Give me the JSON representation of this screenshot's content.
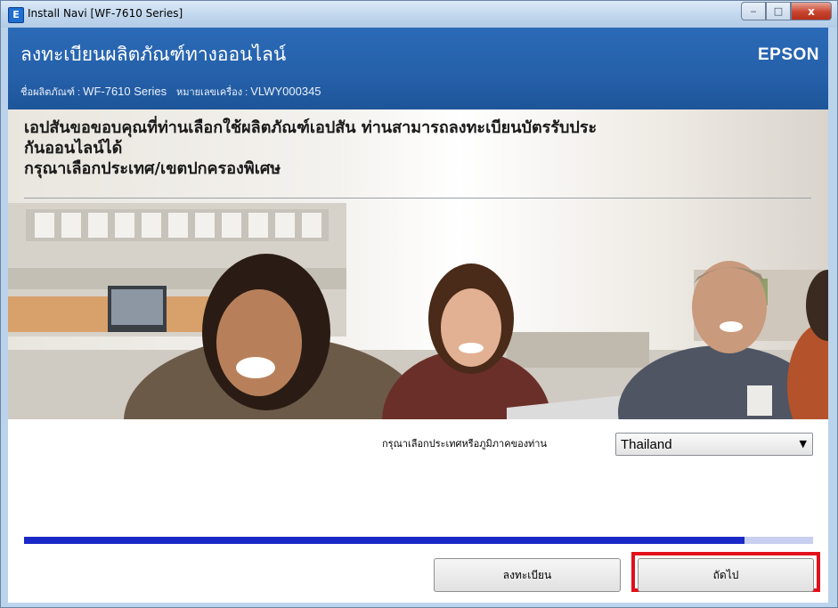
{
  "window": {
    "title": "Install Navi [WF-7610 Series]",
    "app_icon_glyph": "E",
    "controls": {
      "minimize": "‒",
      "maximize": "□",
      "close": "x"
    }
  },
  "header": {
    "title": "ลงทะเบียนผลิตภัณฑ์ทางออนไลน์",
    "brand": "EPSON",
    "product_label": "ชื่อผลิตภัณฑ์ : ",
    "product_value": "WF-7610 Series",
    "serial_label": "หมายเลขเครื่อง : ",
    "serial_value": "VLWY000345"
  },
  "main": {
    "thanks_line1": "เอปสันขอขอบคุณที่ท่านเลือกใช้ผลิตภัณฑ์เอปสัน ท่านสามารถลงทะเบียนบัตรรับประ",
    "thanks_line2": "กันออนไลน์ได้",
    "thanks_line3": "กรุณาเลือกประเทศ/เขตปกครองพิเศษ"
  },
  "form": {
    "country_label": "กรุณาเลือกประเทศหรือภูมิภาคของท่าน",
    "country_selected": "Thailand",
    "dropdown_icon": "chevron-down-icon"
  },
  "progress": {
    "fraction": 0.913
  },
  "buttons": {
    "register": "ลงทะเบียน",
    "next": "ถัดไป"
  },
  "colors": {
    "header_blue": "#2563ad",
    "progress_fill": "#1a28c8",
    "highlight_red": "#e1101a"
  }
}
